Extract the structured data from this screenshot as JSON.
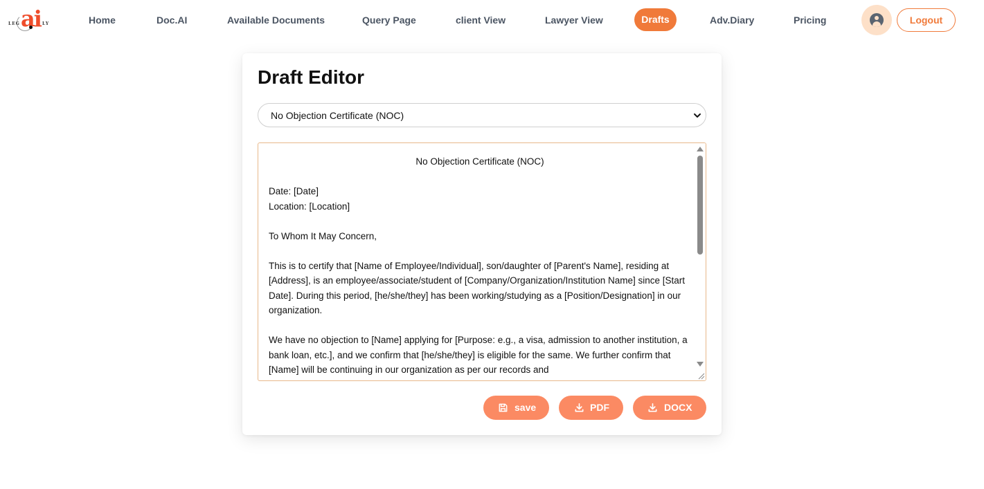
{
  "brand": {
    "logo_text": "ai",
    "logo_left": "LEG",
    "logo_right": "LY"
  },
  "nav": {
    "home": "Home",
    "docai": "Doc.AI",
    "available_documents": "Available Documents",
    "query_page": "Query Page",
    "client_view": "client View",
    "lawyer_view": "Lawyer View",
    "drafts": "Drafts",
    "adv_diary": "Adv.Diary",
    "pricing": "Pricing",
    "logout": "Logout"
  },
  "colors": {
    "accent": "#f07a3a",
    "button": "#fb8a63",
    "avatar_bg": "#fde0c8"
  },
  "editor": {
    "title": "Draft Editor",
    "template_select": "No Objection Certificate (NOC)",
    "doc_title": "No Objection Certificate (NOC)",
    "line_date": "Date: [Date]",
    "line_location": "Location: [Location]",
    "salutation": "To Whom It May Concern,",
    "para1": "This is to certify that [Name of Employee/Individual], son/daughter of [Parent's Name], residing at [Address], is an employee/associate/student of [Company/Organization/Institution Name] since [Start Date]. During this period, [he/she/they] has been working/studying as a [Position/Designation] in our organization.",
    "para2": "We have no objection to [Name] applying for [Purpose: e.g., a visa, admission to another institution, a bank loan, etc.], and we confirm that [he/she/they] is eligible for the same. We further confirm that [Name] will be continuing in our organization as per our records and"
  },
  "actions": {
    "save": "save",
    "pdf": "PDF",
    "docx": "DOCX"
  }
}
